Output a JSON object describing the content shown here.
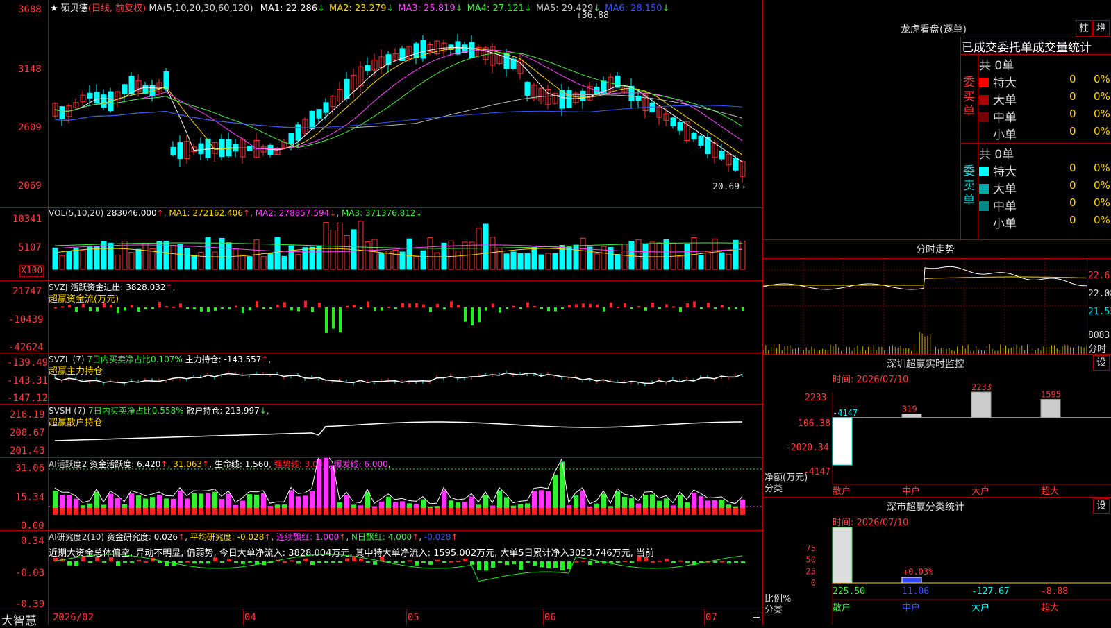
{
  "brand": "大智慧",
  "stock": {
    "name": "硕贝德",
    "period": "(日线, 前复权)"
  },
  "ma_params": "MA(5,10,20,30,60,120)",
  "ma_items": [
    {
      "label": "MA1:",
      "value": "22.286",
      "arrow": "↓",
      "color": "#ffffff"
    },
    {
      "label": "MA2:",
      "value": "23.279",
      "arrow": "↓",
      "color": "#ffd700"
    },
    {
      "label": "MA3:",
      "value": "25.819",
      "arrow": "↓",
      "color": "#ff44ff"
    },
    {
      "label": "MA4:",
      "value": "27.121",
      "arrow": "↓",
      "color": "#44ee44"
    },
    {
      "label": "MA5:",
      "value": "29.429",
      "arrow": "↓",
      "color": "#cccccc"
    },
    {
      "label": "MA6:",
      "value": "28.150",
      "arrow": "↓",
      "color": "#3355ff"
    }
  ],
  "price_axis": [
    "3688",
    "3148",
    "2609",
    "2069"
  ],
  "price_markers": {
    "high": "36.88",
    "low": "20.69"
  },
  "vol": {
    "label": "VOL(5,10,20)",
    "value": "283046.000",
    "ma1": "MA1: 272162.406",
    "ma2": "MA2: 278857.594",
    "ma3": "MA3: 371376.812",
    "axis": [
      "10341",
      "5107"
    ],
    "unit": "X100"
  },
  "svzj": {
    "label": "SVZJ",
    "text": "活跃资金进出: 3828.032",
    "title": "超赢资金流(万元)",
    "axis": [
      "21747",
      "-10439",
      "-42624"
    ]
  },
  "svzl": {
    "label": "SVZL (7)",
    "text1": "7日内买卖净占比0.107%",
    "text2": "主力持仓: -143.557",
    "title": "超赢主力持仓",
    "axis": [
      "-139.49",
      "-143.31",
      "-147.12"
    ]
  },
  "svsh": {
    "label": "SVSH (7)",
    "text1": "7日内买卖净占比0.558%",
    "text2": "散户持仓: 213.997",
    "title": "超赢散户持仓",
    "axis": [
      "216.19",
      "208.67",
      "201.43"
    ]
  },
  "ai1": {
    "label": "AI活跃度2",
    "t1": "资金活跃度: 6.420",
    "t2": "31.063",
    "t3": "生命线: 1.560",
    "t4": "强势线: 3.000",
    "t5": "爆发线: 6.000",
    "axis": [
      "31.06",
      "15.34",
      "0.00"
    ]
  },
  "ai2": {
    "label": "AI研究度2(10)",
    "t1": "资金研究度: 0.026",
    "t2": "平均研究度: -0.028",
    "t3": "连续飘红: 1.000",
    "t4": "N日飘红: 4.000",
    "t5": "-0.028",
    "desc": "近期大资金总体偏空, 异动不明显, 偏弱势, 今日大单净流入: 3828.004万元, 其中特大单净流入: 1595.002万元, 大单5日累计净入3053.746万元, 当前",
    "axis": [
      "0.34",
      "-0.03",
      "-0.39"
    ]
  },
  "date_axis": [
    "2026/02",
    "04",
    "05",
    "06",
    "07"
  ],
  "right": {
    "lhb_title": "龙虎看盘(逐单)",
    "btn_zhu": "柱",
    "btn_stack": "堆",
    "stats_title": "已成交委托单成交量统计",
    "buy_label": [
      "委",
      "买",
      "单"
    ],
    "sell_label": [
      "委",
      "卖",
      "单"
    ],
    "buy_total": "共 0单",
    "sell_total": "共 0单",
    "buy_rows": [
      {
        "name": "特大",
        "vol": "0",
        "pct": "0%",
        "color": "#ff0000"
      },
      {
        "name": "大单",
        "vol": "0",
        "pct": "0%",
        "color": "#aa0000"
      },
      {
        "name": "中单",
        "vol": "0",
        "pct": "0%",
        "color": "#770000"
      },
      {
        "name": "小单",
        "vol": "0",
        "pct": "0%",
        "color": ""
      }
    ],
    "sell_rows": [
      {
        "name": "特大",
        "vol": "0",
        "pct": "0%",
        "color": "#00ffff"
      },
      {
        "name": "大单",
        "vol": "0",
        "pct": "0%",
        "color": "#00aaaa"
      },
      {
        "name": "中单",
        "vol": "0",
        "pct": "0%",
        "color": "#008888"
      },
      {
        "name": "小单",
        "vol": "0",
        "pct": "0%",
        "color": ""
      }
    ],
    "intraday_title": "分时走势",
    "intraday_axis": [
      "22.61",
      "22.08",
      "21.55"
    ],
    "intraday_vol": [
      "8083",
      "分时"
    ],
    "monitor_title": "深圳超赢实时监控",
    "set_btn": "设",
    "time_label": "时间: 2026/07/10",
    "monitor_axis": [
      "2233",
      "106.38",
      "-2020.34",
      "-4147"
    ],
    "monitor_unit": [
      "净额(万元)",
      "分类"
    ],
    "categories": [
      "散户",
      "中户",
      "大户",
      "超大"
    ],
    "monitor_values": [
      "-4147",
      "319",
      "2233",
      "1595"
    ],
    "class_title": "深市超赢分类统计",
    "class_axis": [
      "75",
      "50",
      "25",
      "0"
    ],
    "class_unit": [
      "比例%",
      "分类"
    ],
    "class_pct_label": "+0.03%",
    "class_values": [
      "225.50",
      "11.06",
      "-127.67",
      "-8.88"
    ]
  },
  "chart_data": [
    {
      "type": "bar",
      "title": "深圳超赢实时监控",
      "categories": [
        "散户",
        "中户",
        "大户",
        "超大"
      ],
      "values": [
        -4147,
        319,
        2233,
        1595
      ],
      "ylabel": "净额(万元)",
      "ylim": [
        -4147,
        2233
      ]
    },
    {
      "type": "bar",
      "title": "深市超赢分类统计",
      "categories": [
        "散户",
        "中户",
        "大户",
        "超大"
      ],
      "values": [
        225.5,
        11.06,
        -127.67,
        -8.88
      ],
      "ylabel": "比例%"
    }
  ]
}
